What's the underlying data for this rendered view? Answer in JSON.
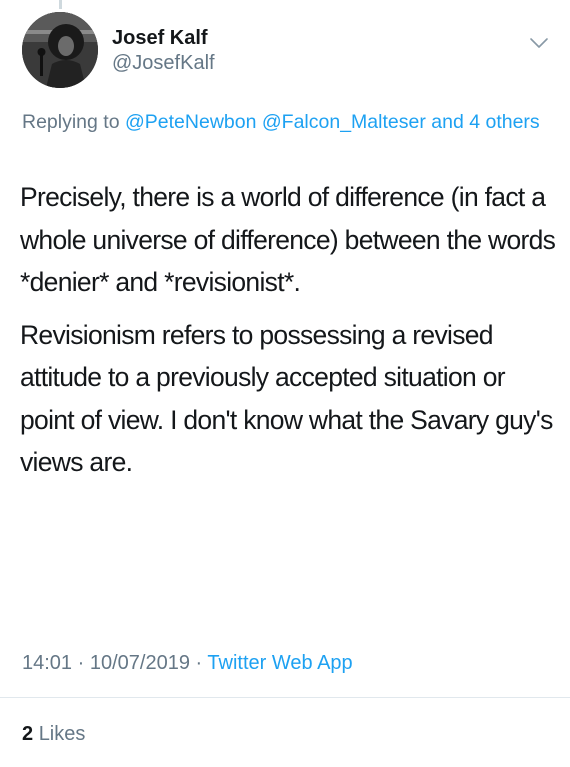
{
  "tweet": {
    "author": {
      "display_name": "Josef Kalf",
      "handle": "@JosefKalf",
      "avatar": "avatar-photo-icon"
    },
    "menu_icon": "chevron-down-icon",
    "reply": {
      "prefix": "Replying to",
      "mention_1": "@PeteNewbon",
      "mention_2": "@Falcon_Malteser",
      "and_text": "and",
      "others": "4 others"
    },
    "body": {
      "paragraph_1": "Precisely, there is a world of difference (in fact a whole universe of difference) between the words *denier* and *revisionist*.",
      "paragraph_2": "Revisionism refers to possessing a revised attitude to a previously accepted situation or point of view. I don't know what the Savary guy's views are."
    },
    "meta": {
      "time": "14:01",
      "separator_1": "·",
      "date": "10/07/2019",
      "separator_2": "·",
      "source": "Twitter Web App"
    },
    "engagement": {
      "likes_count": "2",
      "likes_label": "Likes"
    },
    "colors": {
      "link": "#1da1f2",
      "secondary_text": "#657786",
      "primary_text": "#14171a",
      "divider": "#e1e8ed"
    }
  }
}
